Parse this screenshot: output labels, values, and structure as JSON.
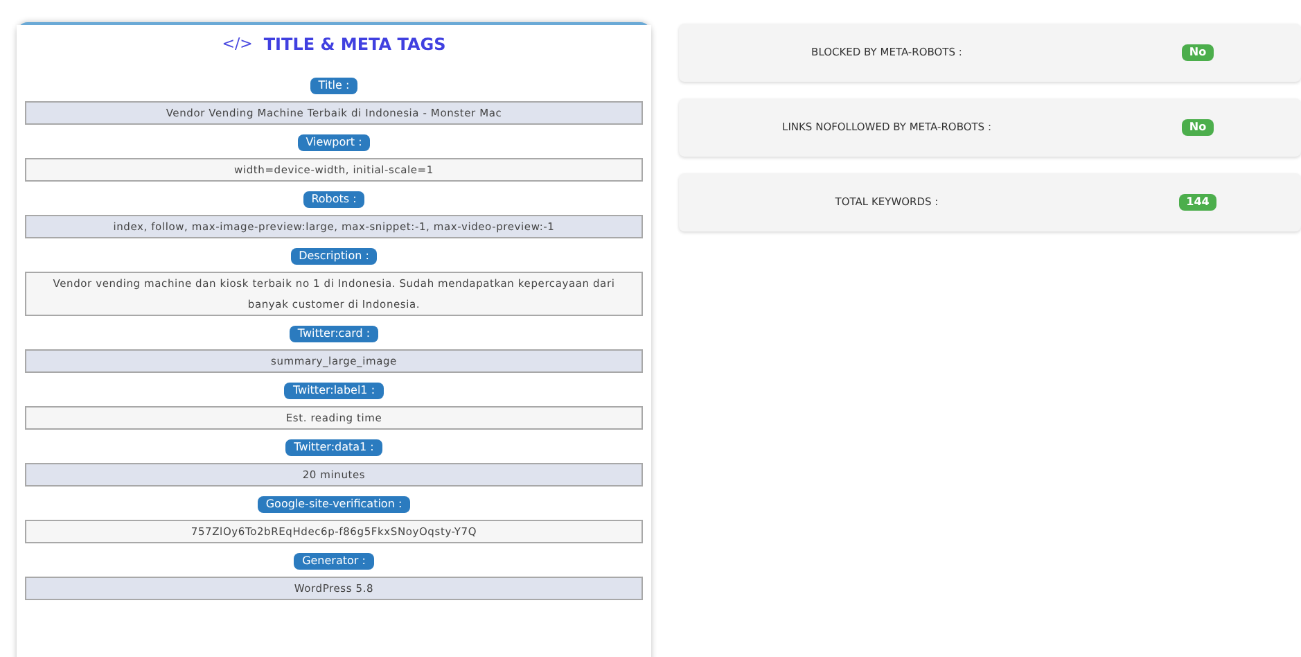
{
  "card": {
    "icon_text": "</>",
    "title": "TITLE & META TAGS"
  },
  "tags": [
    {
      "label": "Title :",
      "value": "Vendor Vending Machine Terbaik di Indonesia - Monster Mac"
    },
    {
      "label": "Viewport :",
      "value": "width=device-width, initial-scale=1"
    },
    {
      "label": "Robots :",
      "value": "index, follow, max-image-preview:large, max-snippet:-1, max-video-preview:-1"
    },
    {
      "label": "Description :",
      "value": "Vendor vending machine dan kiosk terbaik no 1 di Indonesia. Sudah mendapatkan kepercayaan dari banyak customer di Indonesia."
    },
    {
      "label": "Twitter:card :",
      "value": "summary_large_image"
    },
    {
      "label": "Twitter:label1 :",
      "value": "Est. reading time"
    },
    {
      "label": "Twitter:data1 :",
      "value": "20 minutes"
    },
    {
      "label": "Google-site-verification :",
      "value": "757ZlOy6To2bREqHdec6p-f86g5FkxSNoyOqsty-Y7Q"
    },
    {
      "label": "Generator :",
      "value": "WordPress 5.8"
    }
  ],
  "checks": [
    {
      "label": "BLOCKED BY META-ROBOTS :",
      "value": "No"
    },
    {
      "label": "LINKS NOFOLLOWED BY META-ROBOTS :",
      "value": "No"
    },
    {
      "label": "TOTAL KEYWORDS :",
      "value": "144"
    }
  ]
}
